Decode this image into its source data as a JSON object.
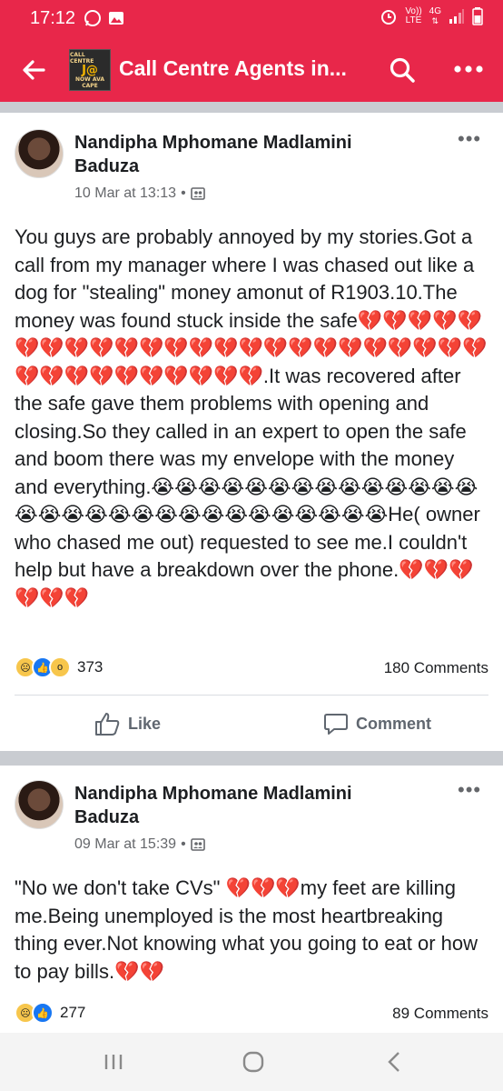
{
  "status_bar": {
    "time": "17:12",
    "network_top": "Vo))",
    "network_bottom": "LTE",
    "signal_type": "4G"
  },
  "app_bar": {
    "title": "Call Centre Agents in...",
    "group_thumbnail_lines": [
      "CALL CENTRE",
      "J@",
      "NOW AVA",
      "CAPE"
    ]
  },
  "posts": [
    {
      "author": "Nandipha Mphomane Madlamini Baduza",
      "timestamp": "10 Mar at 13:13",
      "text": "You guys are probably annoyed by my stories.Got a call from my manager where I was chased out like a dog for \"stealing\" money amonut of R1903.10.The money was found stuck inside the safe💔💔💔💔💔💔💔💔💔💔💔💔💔💔💔💔💔💔💔💔💔💔💔💔💔💔💔💔💔💔💔💔💔💔.It was recovered after the safe gave them problems with opening and closing.So they called in an expert to open the safe and boom there was my envelope with the money and everything.😭😭😭😭😭😭😭😭😭😭😭😭😭😭😭😭😭😭😭😭😭😭😭😭😭😭😭😭😭😭He( owner who chased me out) requested to see me.I couldn't help but have a breakdown over the phone.💔💔💔💔💔💔",
      "reaction_count": "373",
      "comments_label": "180 Comments",
      "like_label": "Like",
      "comment_label": "Comment"
    },
    {
      "author": "Nandipha Mphomane Madlamini Baduza",
      "timestamp": "09 Mar at 15:39",
      "text": "\"No we don't take CVs\" 💔💔💔my feet are killing me.Being unemployed is the most heartbreaking thing ever.Not knowing what you going to eat or how to pay bills.💔💔",
      "reaction_count": "277",
      "comments_label": "89 Comments"
    }
  ],
  "colors": {
    "brand_bar": "#e8274a",
    "separator": "#c9ccd1",
    "like_blue": "#1877f2",
    "secondary_text": "#65676b"
  },
  "icons": [
    "back-arrow-icon",
    "search-icon",
    "more-icon",
    "audience-members-icon",
    "like-thumb-icon",
    "comment-bubble-icon",
    "recent-apps-icon",
    "home-icon",
    "nav-back-icon"
  ]
}
